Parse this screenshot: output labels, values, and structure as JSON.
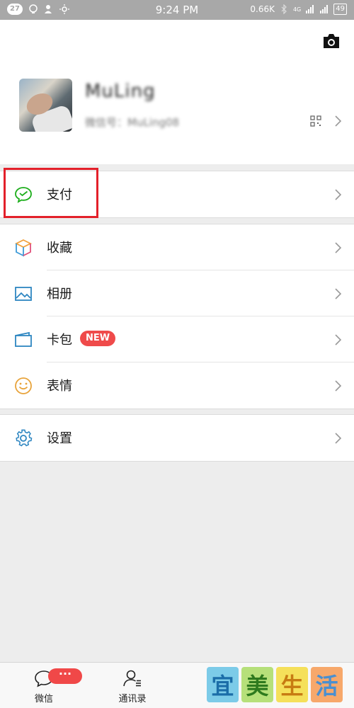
{
  "status_bar": {
    "badge": "27",
    "time": "9:24 PM",
    "net_speed": "0.66K",
    "net_type": "4G",
    "battery": "49"
  },
  "profile": {
    "name": "MuLing",
    "wechat_id": "微信号：MuLing08"
  },
  "menu": {
    "pay_label": "支付",
    "favorites_label": "收藏",
    "album_label": "相册",
    "cards_label": "卡包",
    "cards_badge": "NEW",
    "stickers_label": "表情",
    "settings_label": "设置"
  },
  "tabbar": {
    "chat_label": "微信",
    "chat_badge": "···",
    "contacts_label": "通讯录"
  },
  "watermark": {
    "chars": [
      "宜",
      "美",
      "生",
      "活"
    ]
  },
  "colors": {
    "accent_green": "#1aad19",
    "highlight_red": "#e3202a",
    "badge_red": "#ef4a4a",
    "icon_blue": "#2e86c1"
  }
}
